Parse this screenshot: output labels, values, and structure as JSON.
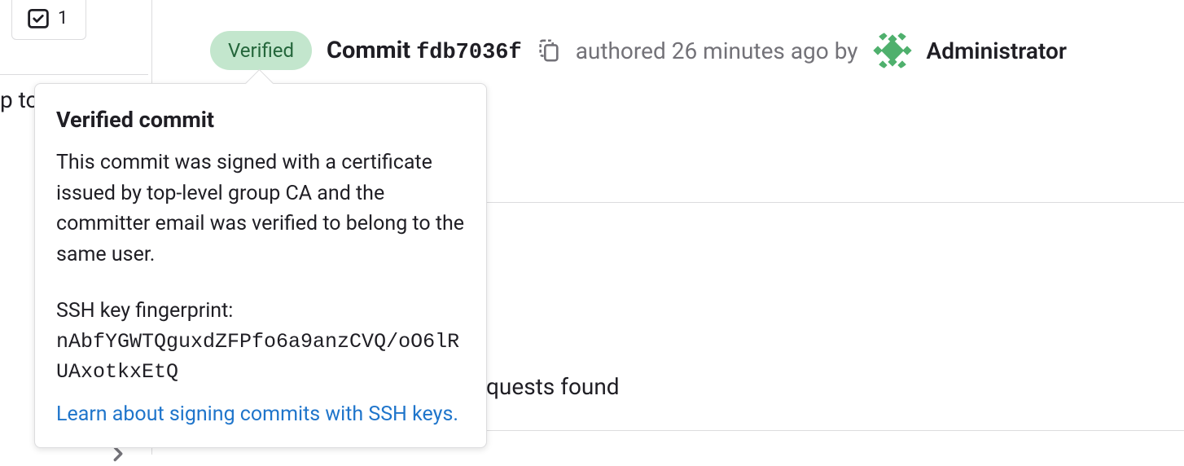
{
  "todo": {
    "count": "1"
  },
  "commit": {
    "verified_badge": "Verified",
    "label": "Commit",
    "hash": "fdb7036f",
    "authored_prefix": "authored",
    "authored_time": "26 minutes ago",
    "authored_by": "by",
    "author_name": "Administrator"
  },
  "popover": {
    "title": "Verified commit",
    "body": "This commit was signed with a certificate issued by top-level group CA and the committer email was verified to belong to the same user.",
    "fingerprint_label": "SSH key fingerprint:",
    "fingerprint_value": "nAbfYGWTQguxdZFPfo6a9anzCVQ/oO6lRUAxotkxEtQ",
    "link_text": "Learn about signing commits with SSH keys."
  },
  "fragments": {
    "left_text": "p to",
    "mr_text": "quests found"
  }
}
